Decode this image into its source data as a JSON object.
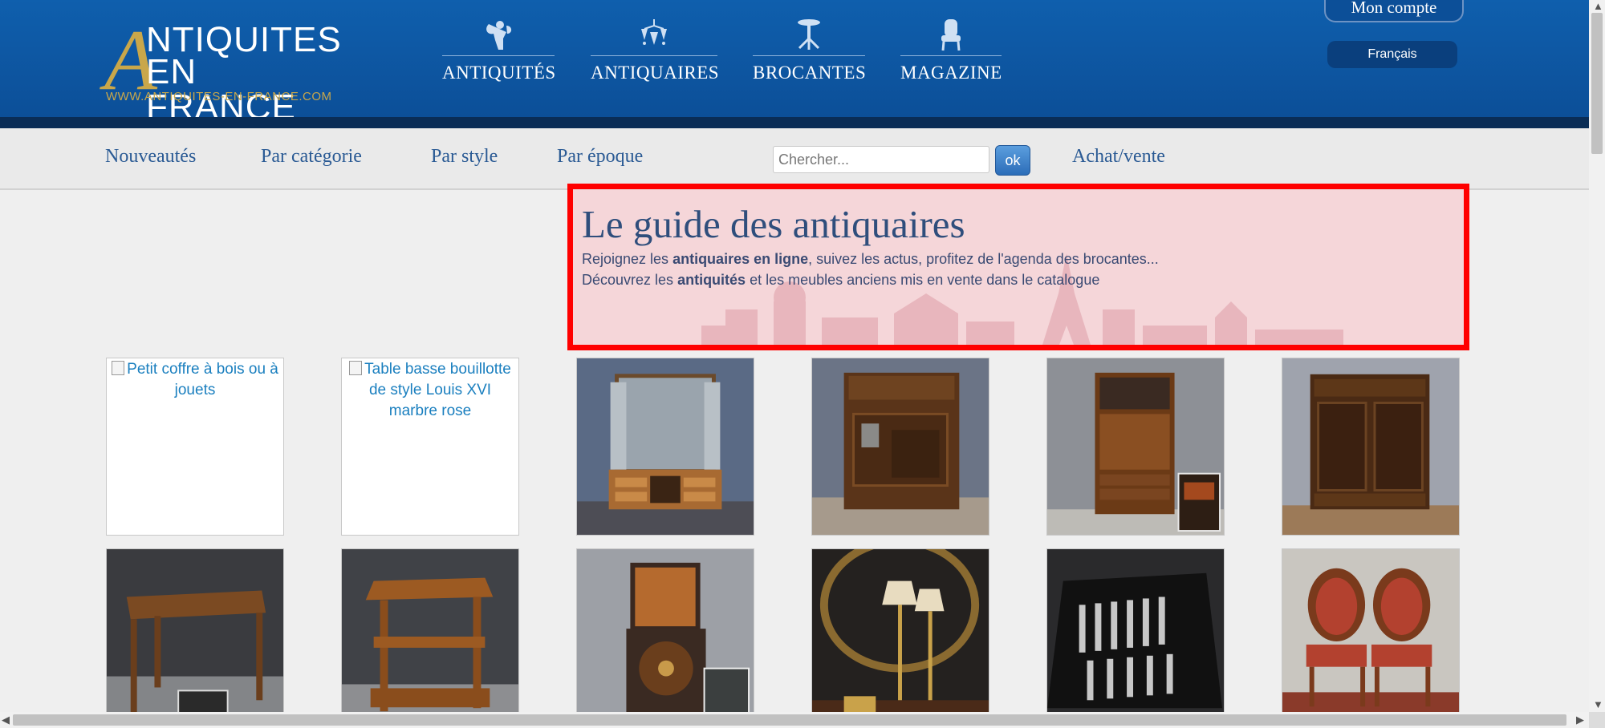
{
  "logo": {
    "big_letter": "A",
    "line1": "NTIQUITES",
    "line2": "EN FRANCE",
    "url": "WWW.ANTIQUITES-EN-FRANCE.COM"
  },
  "main_nav": [
    {
      "label": "ANTIQUITÉS",
      "icon": "cherub-icon"
    },
    {
      "label": "ANTIQUAIRES",
      "icon": "chandelier-icon"
    },
    {
      "label": "BROCANTES",
      "icon": "pedestal-table-icon"
    },
    {
      "label": "MAGAZINE",
      "icon": "armchair-icon"
    }
  ],
  "account": {
    "label": "Mon compte",
    "language": "Français"
  },
  "subnav": {
    "links": [
      "Nouveautés",
      "Par catégorie",
      "Par style",
      "Par époque"
    ],
    "search_placeholder": "Chercher...",
    "search_button": "ok",
    "achat_vente": "Achat/vente"
  },
  "hero": {
    "title": "Le guide des antiquaires",
    "line1_pre": "Rejoignez les ",
    "line1_bold": "antiquaires en ligne",
    "line1_post": ", suivez les actus, profitez de l'agenda des brocantes...",
    "line2_pre": "Découvrez les ",
    "line2_bold": "antiquités",
    "line2_post": " et les meubles anciens mis en vente dans le catalogue"
  },
  "products": [
    {
      "alt": "Petit coffre à bois ou à jouets",
      "broken": true
    },
    {
      "alt": "Table basse bouillotte de style Louis XVI marbre rose",
      "broken": true
    },
    {
      "alt": "",
      "broken": false,
      "icon": "mirror-vanity-image"
    },
    {
      "alt": "",
      "broken": false,
      "icon": "icebox-cabinet-image"
    },
    {
      "alt": "",
      "broken": false,
      "icon": "secretary-desk-image"
    },
    {
      "alt": "",
      "broken": false,
      "icon": "carved-cabinet-image"
    },
    {
      "alt": "",
      "broken": false,
      "icon": "side-table-image"
    },
    {
      "alt": "",
      "broken": false,
      "icon": "etagere-table-image"
    },
    {
      "alt": "",
      "broken": false,
      "icon": "gramophone-case-image"
    },
    {
      "alt": "",
      "broken": false,
      "icon": "table-lamps-image"
    },
    {
      "alt": "",
      "broken": false,
      "icon": "silverware-box-image"
    },
    {
      "alt": "",
      "broken": false,
      "icon": "pair-armchairs-image"
    }
  ],
  "colors": {
    "header_blue": "#0f5fad",
    "gold": "#c9a74a",
    "link_blue": "#2a5a94",
    "highlight_border": "#ff0000"
  }
}
